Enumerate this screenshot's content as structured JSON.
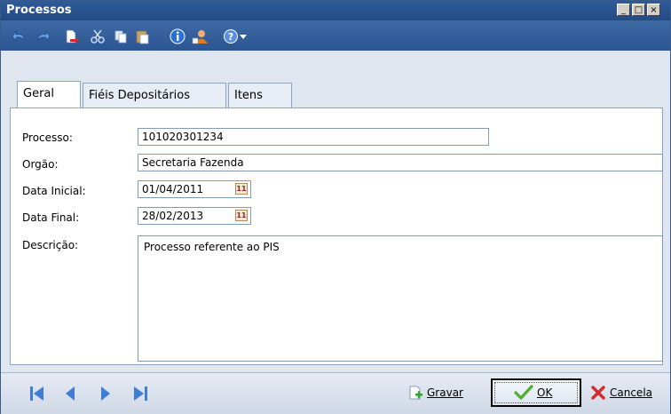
{
  "window": {
    "title": "Processos"
  },
  "window_controls": {
    "minimize": "_",
    "maximize": "□",
    "close": "×"
  },
  "toolbar": {
    "icons": [
      "undo-icon",
      "redo-icon",
      "new-document-icon",
      "cut-icon",
      "copy-icon",
      "paste-icon",
      "info-icon",
      "user-icon",
      "help-icon"
    ]
  },
  "tabs": [
    {
      "label": "Geral"
    },
    {
      "label": "Fiéis Depositários"
    },
    {
      "label": "Itens"
    }
  ],
  "form": {
    "processo": {
      "label": "Processo:",
      "value": "101020301234"
    },
    "orgao": {
      "label": "Orgão:",
      "value": "Secretaria Fazenda"
    },
    "data_inicial": {
      "label": "Data Inicial:",
      "value": "01/04/2011"
    },
    "data_final": {
      "label": "Data Final:",
      "value": "28/02/2013"
    },
    "descricao": {
      "label": "Descrição:",
      "value": "Processo referente ao PIS"
    }
  },
  "buttons": {
    "gravar": "Gravar",
    "ok": "OK",
    "cancela": "Cancela"
  },
  "colors": {
    "titlebar": "#2f5b9a",
    "toolbar": "#3d6aa5",
    "nav_arrows": "#3f7cd6"
  }
}
